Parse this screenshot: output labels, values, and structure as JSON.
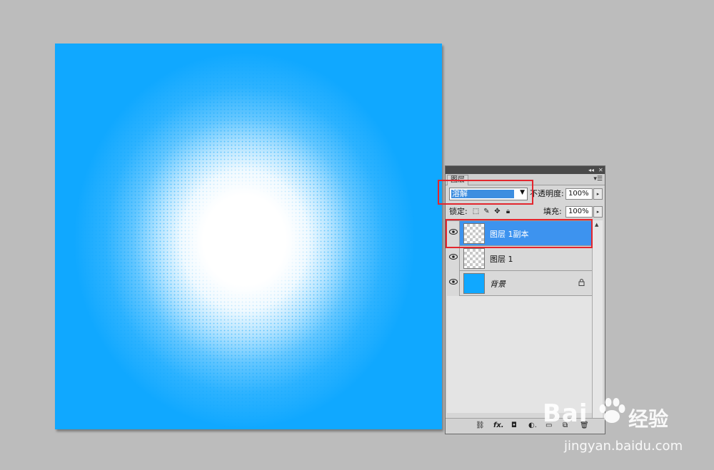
{
  "panel": {
    "tab_label": "图层",
    "titlebar": {
      "collapse": "◂◂",
      "close": "✕"
    },
    "menu_icon": "menu-icon",
    "blend_mode": "溶解",
    "opacity_label": "不透明度:",
    "opacity_value": "100%",
    "lock_label": "锁定:",
    "fill_label": "填充:",
    "fill_value": "100%",
    "layers": [
      {
        "name": "图层 1副本",
        "selected": true
      },
      {
        "name": "图层 1",
        "selected": false
      },
      {
        "name": "背景",
        "selected": false,
        "locked": true
      }
    ]
  },
  "canvas": {
    "color": "#10a8ff"
  },
  "watermark": {
    "brand": "Bai",
    "brand2": "经验",
    "url": "jingyan.baidu.com"
  },
  "colors": {
    "highlight": "#e3262e",
    "selection": "#3d93ef"
  }
}
